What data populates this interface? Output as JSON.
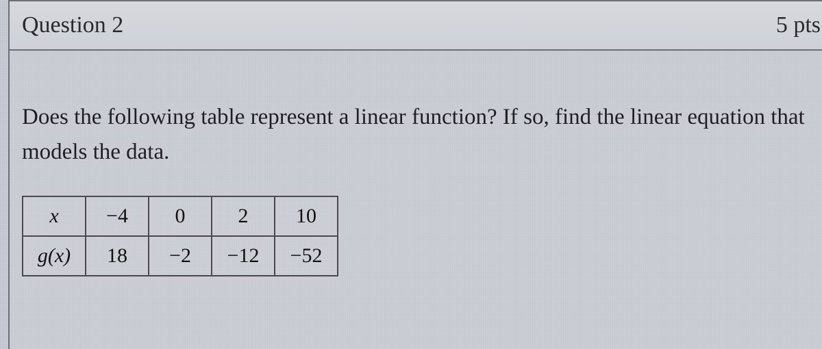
{
  "header": {
    "title": "Question 2",
    "points": "5 pts"
  },
  "body": {
    "prompt": "Does the following table represent a linear function? If so, find the linear equation that models the data."
  },
  "chart_data": {
    "type": "table",
    "row_labels": [
      "x",
      "g(x)"
    ],
    "columns": [
      "−4",
      "0",
      "2",
      "10"
    ],
    "rows": [
      [
        "−4",
        "0",
        "2",
        "10"
      ],
      [
        "18",
        "−2",
        "−12",
        "−52"
      ]
    ]
  }
}
